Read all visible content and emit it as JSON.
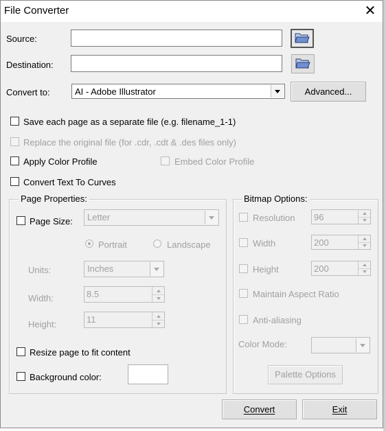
{
  "window": {
    "title": "File Converter",
    "close_glyph": "✕"
  },
  "source": {
    "label": "Source:",
    "value": "",
    "browse_icon": "folder-open-icon"
  },
  "destination": {
    "label": "Destination:",
    "value": "",
    "browse_icon": "folder-open-icon"
  },
  "convert_to": {
    "label": "Convert to:",
    "selected": "AI - Adobe Illustrator",
    "advanced_label": "Advanced..."
  },
  "options": {
    "save_each_page": "Save each page as a separate file (e.g. filename_1-1)",
    "replace_original": "Replace the original file (for .cdr, .cdt & .des files only)",
    "apply_color_profile": "Apply Color Profile",
    "embed_color_profile": "Embed Color Profile",
    "convert_text_to_curves": "Convert Text To Curves"
  },
  "page_properties": {
    "title": "Page Properties:",
    "page_size_label": "Page Size:",
    "page_size_value": "Letter",
    "portrait_label": "Portrait",
    "landscape_label": "Landscape",
    "orientation_selected": "Portrait",
    "units_label": "Units:",
    "units_value": "Inches",
    "width_label": "Width:",
    "width_value": "8.5",
    "height_label": "Height:",
    "height_value": "11",
    "resize_label": "Resize page to fit content",
    "background_label": "Background color:",
    "background_color": "#ffffff"
  },
  "bitmap_options": {
    "title": "Bitmap Options:",
    "resolution_label": "Resolution",
    "resolution_value": "96",
    "width_label": "Width",
    "width_value": "200",
    "height_label": "Height",
    "height_value": "200",
    "maintain_aspect_label": "Maintain Aspect Ratio",
    "antialiasing_label": "Anti-aliasing",
    "color_mode_label": "Color Mode:",
    "color_mode_value": "",
    "palette_button": "Palette Options"
  },
  "footer": {
    "convert_button": "Convert",
    "exit_button": "Exit"
  },
  "colors": {
    "dialog_bg": "#f0f0f0",
    "disabled_text": "#a0a0a0",
    "button_face": "#e1e1e1"
  }
}
